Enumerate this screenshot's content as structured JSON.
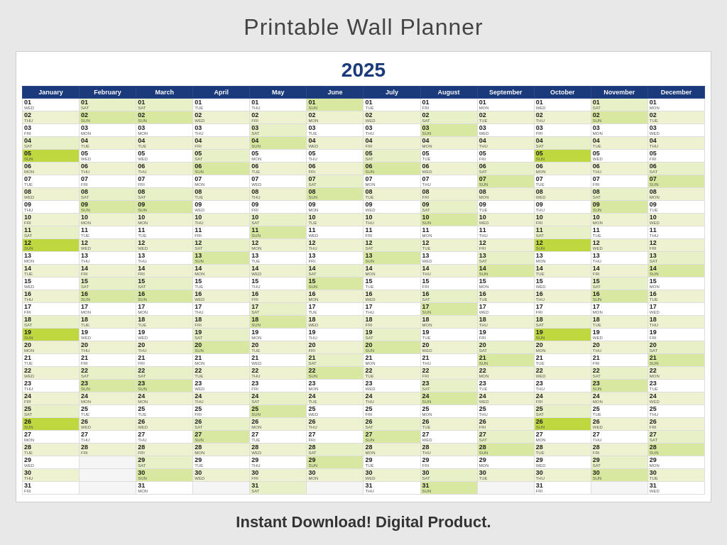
{
  "title": "Printable Wall Planner",
  "year": "2025",
  "subtitle": "Instant Download!  Digital Product.",
  "months": [
    "January",
    "February",
    "March",
    "April",
    "May",
    "June",
    "July",
    "August",
    "September",
    "October",
    "November",
    "December"
  ],
  "days_in_months": [
    31,
    28,
    31,
    30,
    31,
    30,
    31,
    31,
    30,
    31,
    30,
    31
  ],
  "start_days": [
    3,
    6,
    6,
    2,
    4,
    0,
    2,
    5,
    1,
    3,
    6,
    1
  ],
  "day_names": [
    "WED",
    "THU",
    "FRI",
    "SAT",
    "SUN",
    "MON",
    "TUE",
    "WED",
    "THU",
    "FRI",
    "SAT",
    "SUN",
    "MON",
    "TUE",
    "WED",
    "THU",
    "FRI",
    "SAT",
    "SUN",
    "MON",
    "TUE",
    "WED",
    "THU",
    "FRI",
    "SAT",
    "SUN",
    "MON",
    "TUE",
    "WED",
    "THU",
    "FRI"
  ],
  "colors": {
    "header_bg": "#1a3a7c",
    "header_text": "#ffffff",
    "row_even": "#eef2d0",
    "row_odd": "#ffffff",
    "highlight_green": "#b8d020",
    "year_color": "#1a3a7c",
    "title_color": "#444444",
    "subtitle_color": "#333333"
  }
}
